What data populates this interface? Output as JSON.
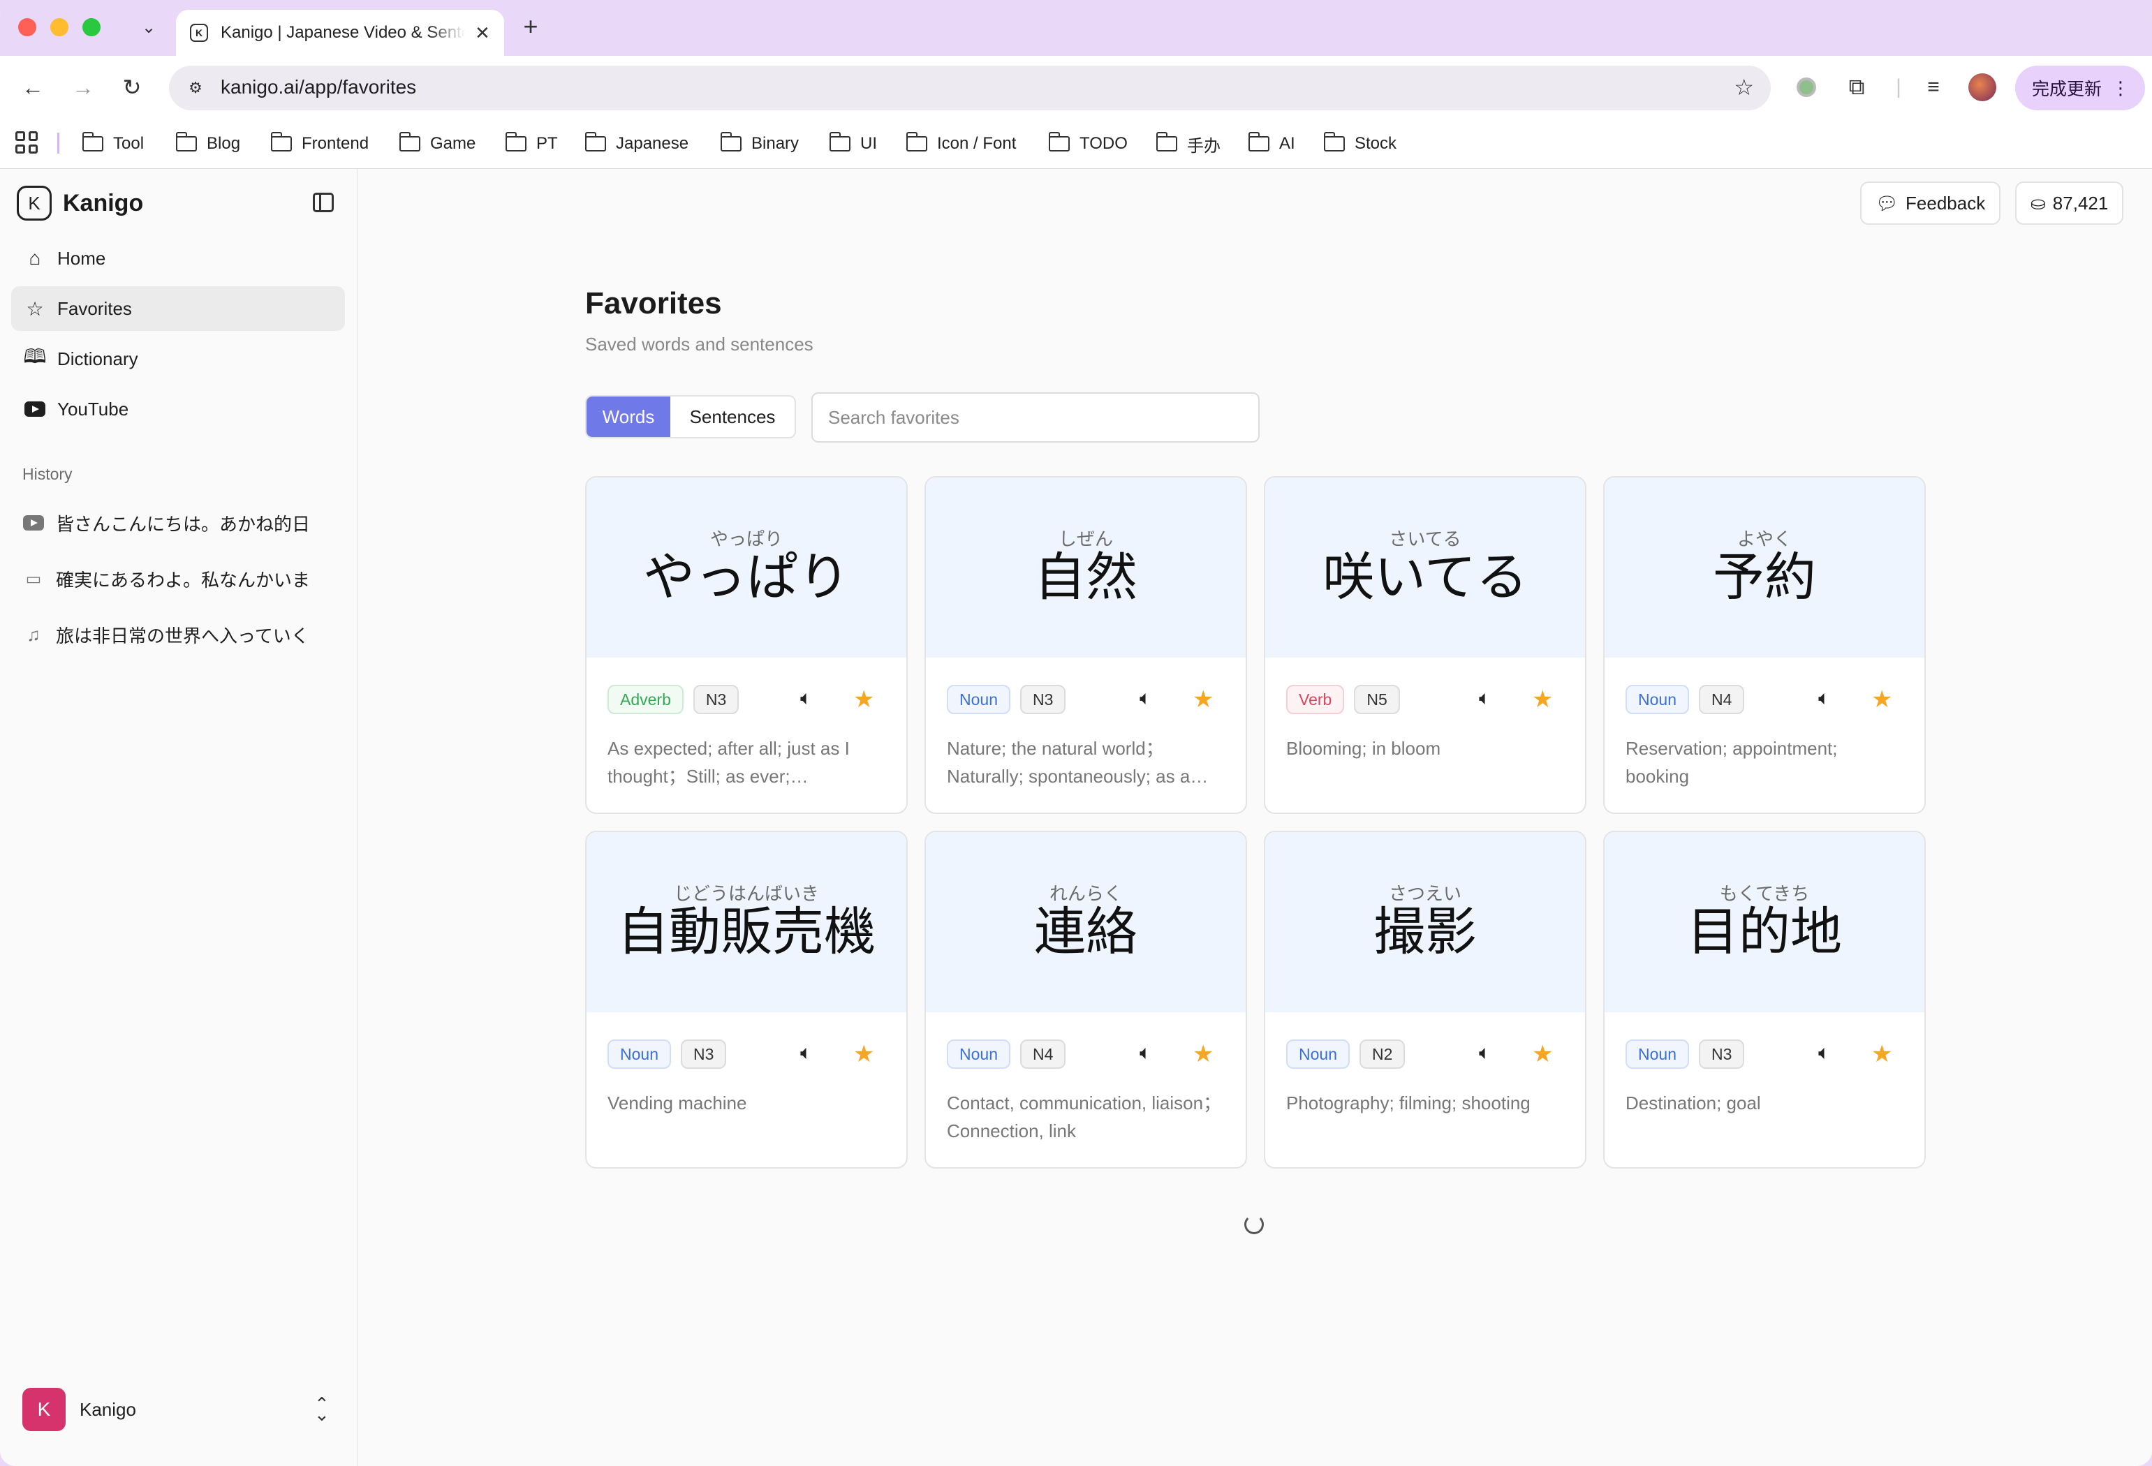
{
  "browser": {
    "tab_title": "Kanigo | Japanese Video & Sentence",
    "tab_favicon": "K",
    "url": "kanigo.ai/app/favorites",
    "update_label": "完成更新",
    "bookmarks": [
      "Tool",
      "Blog",
      "Frontend",
      "Game",
      "PT",
      "Japanese",
      "Binary",
      "UI",
      "Icon / Font",
      "TODO",
      "手办",
      "AI",
      "Stock"
    ]
  },
  "sidebar": {
    "brand": "Kanigo",
    "brand_logo": "K",
    "nav": [
      {
        "label": "Home",
        "icon": "home-icon"
      },
      {
        "label": "Favorites",
        "icon": "star-icon"
      },
      {
        "label": "Dictionary",
        "icon": "book-icon"
      },
      {
        "label": "YouTube",
        "icon": "youtube-icon"
      }
    ],
    "history_label": "History",
    "history": [
      {
        "label": "皆さんこんにちは。あかね的日",
        "icon": "youtube-icon"
      },
      {
        "label": "確実にあるわよ。私なんかいま",
        "icon": "video-icon"
      },
      {
        "label": "旅は非日常の世界へ入っていく",
        "icon": "music-icon"
      }
    ],
    "user": {
      "initial": "K",
      "name": "Kanigo"
    }
  },
  "header": {
    "feedback_label": "Feedback",
    "credits": "87,421"
  },
  "page": {
    "title": "Favorites",
    "subtitle": "Saved words and sentences",
    "tabs": {
      "words": "Words",
      "sentences": "Sentences"
    },
    "search_placeholder": "Search favorites"
  },
  "cards": [
    {
      "reading": "やっぱり",
      "word": "やっぱり",
      "pos": "Adverb",
      "level": "N3",
      "meaning": "As expected; after all; just as I thought；Still; as ever; nevertheless"
    },
    {
      "reading": "しぜん",
      "word": "自然",
      "pos": "Noun",
      "level": "N3",
      "meaning": "Nature; the natural world；Naturally; spontaneously; as a matter of course"
    },
    {
      "reading": "さいてる",
      "word": "咲いてる",
      "pos": "Verb",
      "level": "N5",
      "meaning": "Blooming; in bloom"
    },
    {
      "reading": "よやく",
      "word": "予約",
      "pos": "Noun",
      "level": "N4",
      "meaning": "Reservation; appointment; booking"
    },
    {
      "reading": "じどうはんばいき",
      "word": "自動販売機",
      "pos": "Noun",
      "level": "N3",
      "meaning": "Vending machine"
    },
    {
      "reading": "れんらく",
      "word": "連絡",
      "pos": "Noun",
      "level": "N4",
      "meaning": "Contact, communication, liaison；Connection, link"
    },
    {
      "reading": "さつえい",
      "word": "撮影",
      "pos": "Noun",
      "level": "N2",
      "meaning": "Photography; filming; shooting"
    },
    {
      "reading": "もくてきち",
      "word": "目的地",
      "pos": "Noun",
      "level": "N3",
      "meaning": "Destination; goal"
    }
  ],
  "colors": {
    "accent": "#6f79e8",
    "star": "#f5a623",
    "card_header": "#eef5fe",
    "adverb": "#35a853",
    "noun": "#3b6fd4",
    "verb": "#d9475f",
    "avatar": "#d6336c"
  }
}
